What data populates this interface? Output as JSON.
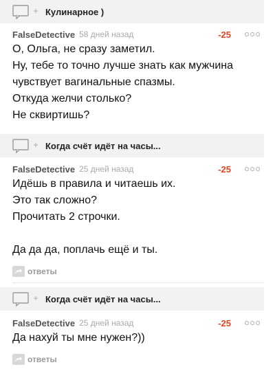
{
  "threads": [
    {
      "post_title": "Кулинарное )",
      "author": "FalseDetective",
      "date": "58 дней назад",
      "rating": "-25",
      "lines": [
        "О, Ольга, не сразу заметил.",
        "Ну, тебе то точно лучше знать как мужчина",
        "чувствует вагинальные спазмы.",
        "Откуда желчи столько?",
        "Не сквиртишь?"
      ],
      "replies_label": ""
    },
    {
      "post_title": "Когда счёт идёт на часы...",
      "author": "FalseDetective",
      "date": "25 дней назад",
      "rating": "-25",
      "lines": [
        "Идёшь в правила и читаешь их.",
        "Это так сложно?",
        "Прочитать 2 строчки.",
        "",
        "Да да да, поплачь ещё и ты."
      ],
      "replies_label": "ответы"
    },
    {
      "post_title": "Когда счёт идёт на часы...",
      "author": "FalseDetective",
      "date": "25 дней назад",
      "rating": "-25",
      "lines": [
        "Да нахуй ты мне нужен?))"
      ],
      "replies_label": "ответы"
    }
  ],
  "colors": {
    "rating": "#e4431f",
    "post_bar": "#f2f2f2"
  },
  "icons": {
    "post_ref": "comment-bubble-add-icon",
    "replies": "reply-arrow-icon",
    "more": "more-dots-icon"
  }
}
